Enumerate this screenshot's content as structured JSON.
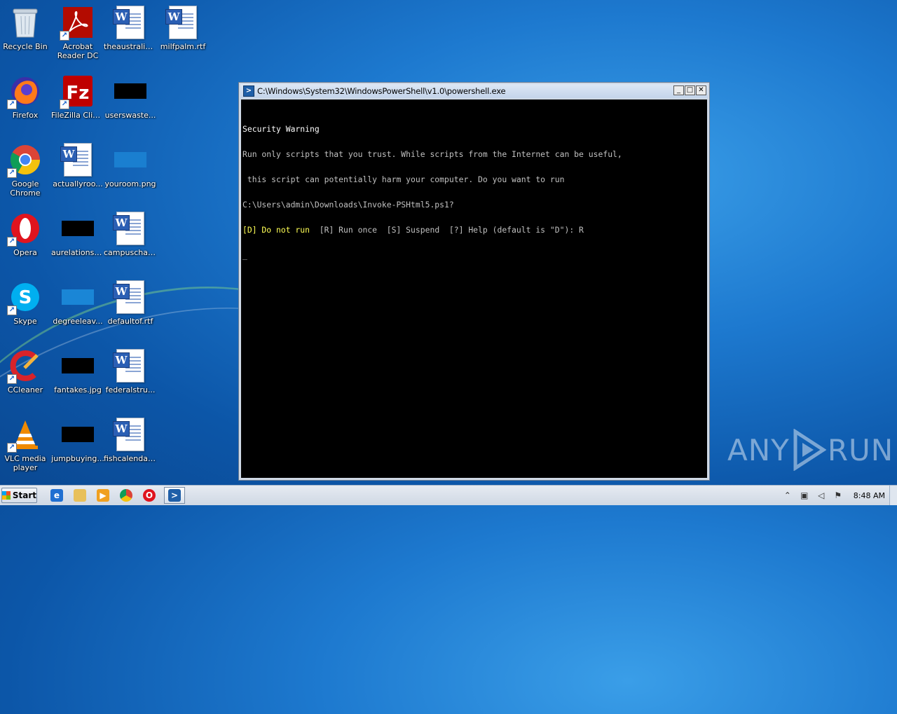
{
  "desktop": {
    "icons": [
      {
        "label": "Recycle Bin"
      },
      {
        "label": "Acrobat Reader DC"
      },
      {
        "label": "theaustralia..."
      },
      {
        "label": "milfpalm.rtf"
      },
      {
        "label": "Firefox"
      },
      {
        "label": "FileZilla Client"
      },
      {
        "label": "userswaste..."
      },
      {
        "label": "Google Chrome"
      },
      {
        "label": "actuallyroo..."
      },
      {
        "label": "youroom.png"
      },
      {
        "label": "Opera"
      },
      {
        "label": "aurelationsh..."
      },
      {
        "label": "campuschar..."
      },
      {
        "label": "Skype"
      },
      {
        "label": "degreeleav..."
      },
      {
        "label": "defaultof.rtf"
      },
      {
        "label": "CCleaner"
      },
      {
        "label": "fantakes.jpg"
      },
      {
        "label": "federalstru..."
      },
      {
        "label": "VLC media player"
      },
      {
        "label": "jumpbuying..."
      },
      {
        "label": "fishcalendar..."
      }
    ]
  },
  "window": {
    "title": "C:\\Windows\\System32\\WindowsPowerShell\\v1.0\\powershell.exe",
    "buttons": {
      "minimize": "_",
      "maximize": "□",
      "close": "✕"
    }
  },
  "console": {
    "line1": "Security Warning",
    "line2": "Run only scripts that you trust. While scripts from the Internet can be useful,",
    "line3": " this script can potentially harm your computer. Do you want to run",
    "line4": "C:\\Users\\admin\\Downloads\\Invoke-PSHtml5.ps1?",
    "prompt_default": "[D] Do not run",
    "prompt_rest": "  [R] Run once  [S] Suspend  [?] Help (default is \"D\"): R",
    "cursor": "_"
  },
  "watermark": {
    "left": "ANY",
    "right": "RUN"
  },
  "taskbar": {
    "start_label": "Start",
    "clock": "8:48 AM"
  }
}
